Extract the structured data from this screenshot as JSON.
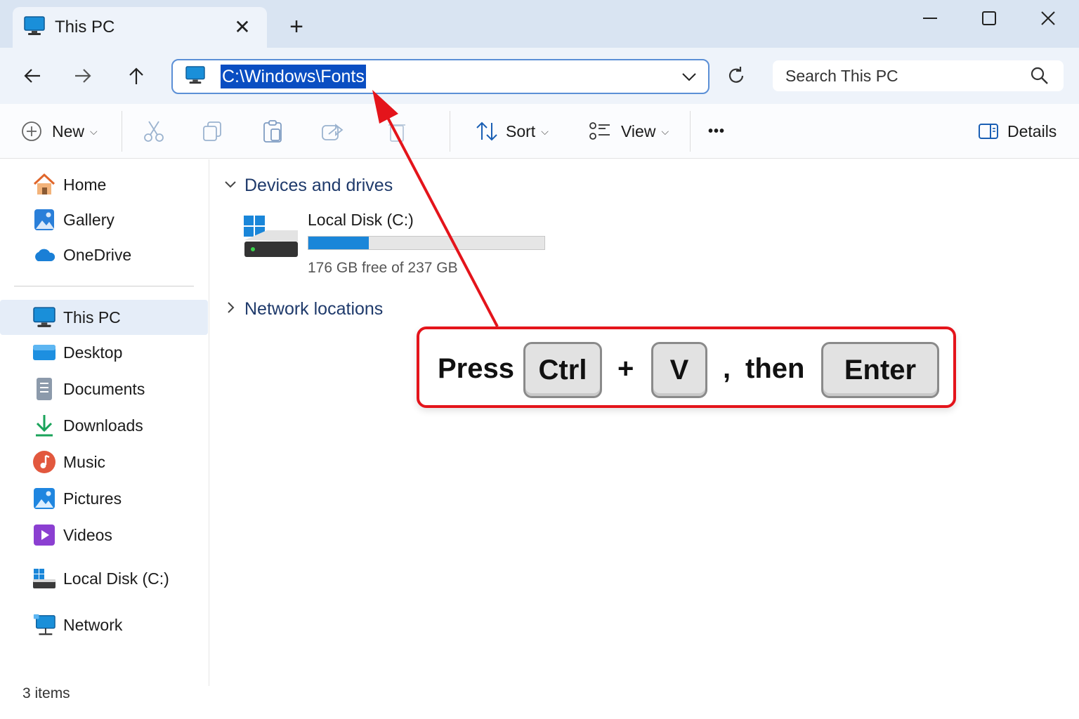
{
  "window": {
    "tab_title": "This PC",
    "close_tab_glyph": "✕",
    "new_tab_glyph": "+"
  },
  "address_bar": {
    "path": "C:\\Windows\\Fonts"
  },
  "search": {
    "placeholder": "Search This PC"
  },
  "toolbar": {
    "new_label": "New",
    "sort_label": "Sort",
    "view_label": "View",
    "more_label": "•••",
    "details_label": "Details"
  },
  "sidebar": {
    "items": [
      {
        "label": "Home",
        "icon": "home-icon"
      },
      {
        "label": "Gallery",
        "icon": "gallery-icon"
      },
      {
        "label": "OneDrive",
        "icon": "onedrive-icon"
      },
      {
        "label": "This PC",
        "icon": "this-pc-icon",
        "selected": true
      },
      {
        "label": "Desktop",
        "icon": "desktop-icon"
      },
      {
        "label": "Documents",
        "icon": "documents-icon"
      },
      {
        "label": "Downloads",
        "icon": "downloads-icon"
      },
      {
        "label": "Music",
        "icon": "music-icon"
      },
      {
        "label": "Pictures",
        "icon": "pictures-icon"
      },
      {
        "label": "Videos",
        "icon": "videos-icon"
      },
      {
        "label": "Local Disk (C:)",
        "icon": "local-disk-icon"
      },
      {
        "label": "Network",
        "icon": "network-icon"
      }
    ]
  },
  "main": {
    "devices_header": "Devices and drives",
    "network_header": "Network locations",
    "drive": {
      "name": "Local Disk (C:)",
      "free_text": "176 GB free of 237 GB",
      "used_fraction": 0.2574
    }
  },
  "status_bar": {
    "items_text": "3 items"
  },
  "callout": {
    "press": "Press",
    "key_ctrl": "Ctrl",
    "plus": "+",
    "key_v": "V",
    "comma": ",",
    "then": "then",
    "key_enter": "Enter"
  },
  "colors": {
    "accent": "#0a4ec2",
    "callout_border": "#e4141b",
    "drive_fill": "#1a86d9"
  }
}
